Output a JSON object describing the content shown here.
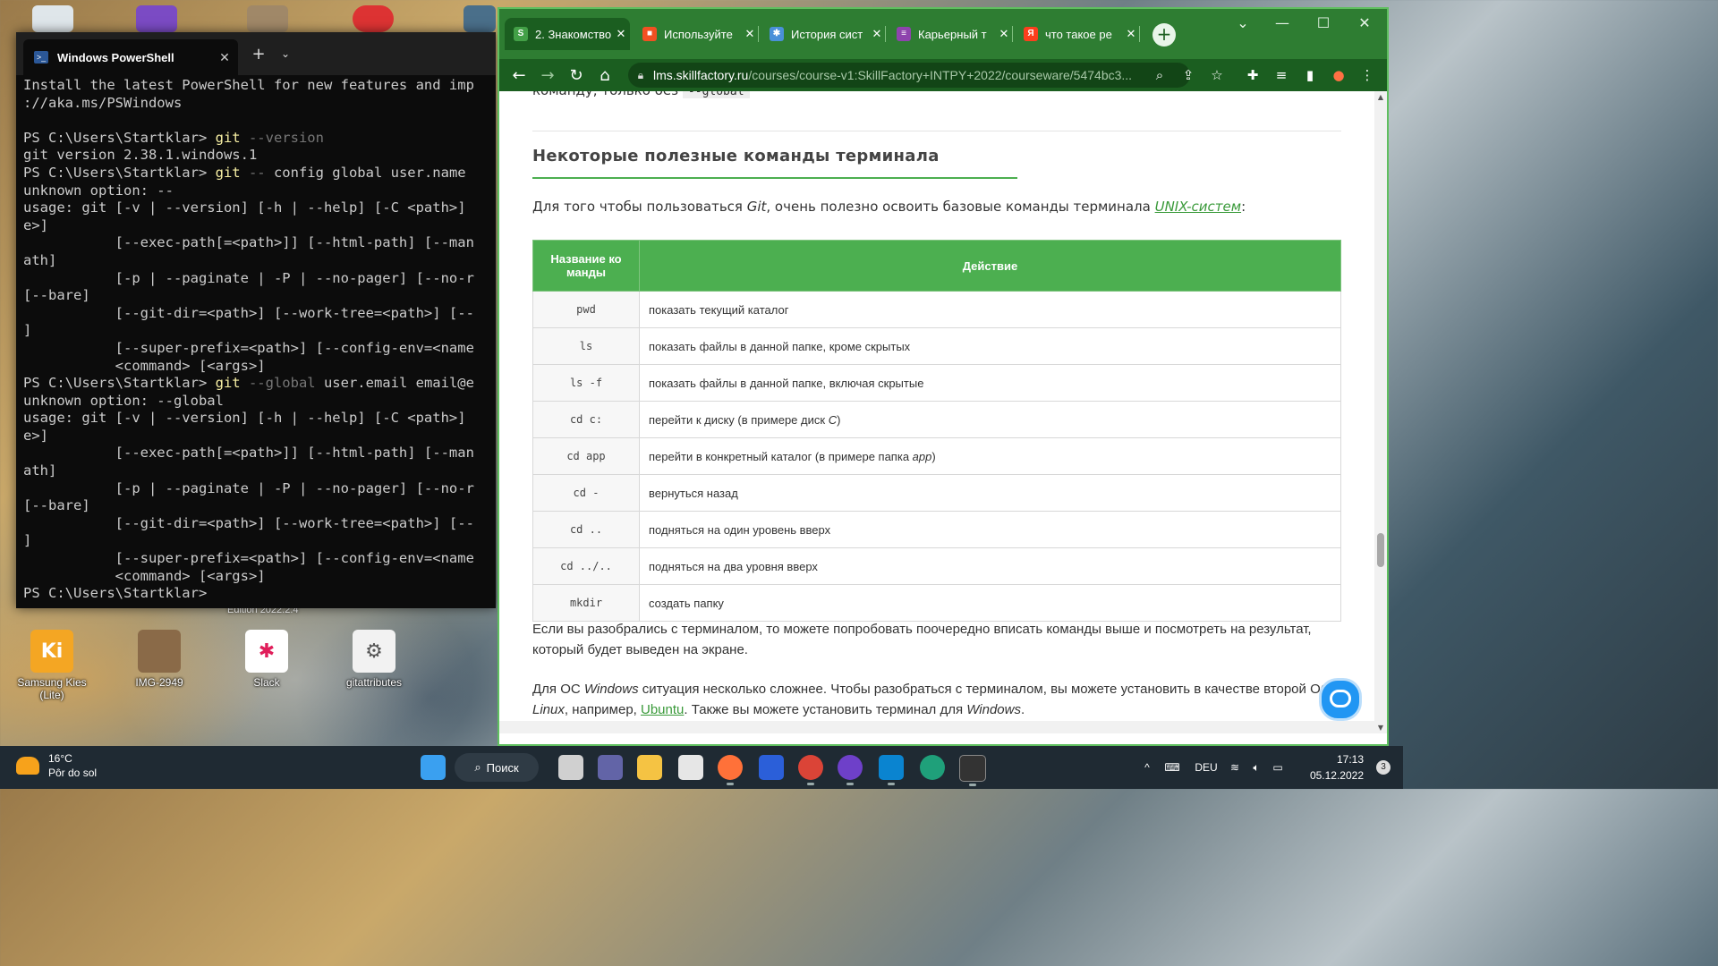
{
  "desktop": {
    "icons": [
      {
        "label": "Samsung Kies (Lite)"
      },
      {
        "label": "IMG-2949"
      },
      {
        "label": "Slack"
      },
      {
        "label": "gitattributes"
      }
    ],
    "partial_label": "Edition 2022.2.4"
  },
  "powershell": {
    "tab_title": "Windows PowerShell",
    "lines": [
      [
        {
          "t": "Install the latest PowerShell for new features and imp"
        }
      ],
      [
        {
          "t": "://aka.ms/PSWindows"
        }
      ],
      [
        {
          "t": ""
        }
      ],
      [
        {
          "t": "PS C:\\Users\\Startklar> "
        },
        {
          "t": "git",
          "c": "cmd"
        },
        {
          "t": " --version",
          "c": "param"
        }
      ],
      [
        {
          "t": "git version 2.38.1.windows.1"
        }
      ],
      [
        {
          "t": "PS C:\\Users\\Startklar> "
        },
        {
          "t": "git",
          "c": "cmd"
        },
        {
          "t": " --",
          "c": "param"
        },
        {
          "t": " config global user.name "
        }
      ],
      [
        {
          "t": "unknown option: --"
        }
      ],
      [
        {
          "t": "usage: git [-v | --version] [-h | --help] [-C <path>] "
        }
      ],
      [
        {
          "t": "e>]"
        }
      ],
      [
        {
          "t": "           [--exec-path[=<path>]] [--html-path] [--man"
        }
      ],
      [
        {
          "t": "ath]"
        }
      ],
      [
        {
          "t": "           [-p | --paginate | -P | --no-pager] [--no-r"
        }
      ],
      [
        {
          "t": "[--bare]"
        }
      ],
      [
        {
          "t": "           [--git-dir=<path>] [--work-tree=<path>] [--"
        }
      ],
      [
        {
          "t": "]"
        }
      ],
      [
        {
          "t": "           [--super-prefix=<path>] [--config-env=<name"
        }
      ],
      [
        {
          "t": "           <command> [<args>]"
        }
      ],
      [
        {
          "t": "PS C:\\Users\\Startklar> "
        },
        {
          "t": "git",
          "c": "cmd"
        },
        {
          "t": " --global",
          "c": "param"
        },
        {
          "t": " user.email email@e"
        }
      ],
      [
        {
          "t": "unknown option: --global"
        }
      ],
      [
        {
          "t": "usage: git [-v | --version] [-h | --help] [-C <path>] "
        }
      ],
      [
        {
          "t": "e>]"
        }
      ],
      [
        {
          "t": "           [--exec-path[=<path>]] [--html-path] [--man"
        }
      ],
      [
        {
          "t": "ath]"
        }
      ],
      [
        {
          "t": "           [-p | --paginate | -P | --no-pager] [--no-r"
        }
      ],
      [
        {
          "t": "[--bare]"
        }
      ],
      [
        {
          "t": "           [--git-dir=<path>] [--work-tree=<path>] [--"
        }
      ],
      [
        {
          "t": "]"
        }
      ],
      [
        {
          "t": "           [--super-prefix=<path>] [--config-env=<name"
        }
      ],
      [
        {
          "t": "           <command> [<args>]"
        }
      ],
      [
        {
          "t": "PS C:\\Users\\Startklar> "
        }
      ]
    ]
  },
  "browser": {
    "tabs": [
      {
        "label": "2. Знакомство",
        "fav": "S",
        "color": "#43a047",
        "active": true
      },
      {
        "label": "Используйте",
        "fav": "■",
        "color": "#f25022"
      },
      {
        "label": "История сист",
        "fav": "✱",
        "color": "#4a90d9"
      },
      {
        "label": "Карьерный т",
        "fav": "≡",
        "color": "#8e44ad"
      },
      {
        "label": "что такое ре",
        "fav": "Я",
        "color": "#fc3f1d"
      }
    ],
    "url_host": "lms.skillfactory.ru",
    "url_path": "/courses/course-v1:SkillFactory+INTPY+2022/courseware/5474bc3...",
    "accent_color": "#4caf50"
  },
  "article": {
    "prev_text": "команду, только без",
    "prev_code": "--global",
    "heading": "Некоторые полезные команды терминала",
    "intro_before": "Для того чтобы пользоваться ",
    "intro_git": "Git",
    "intro_mid": ", очень полезно освоить базовые команды терминала ",
    "intro_link": "UNIX-систем",
    "intro_after": ":",
    "table": {
      "headers": [
        "Название ко манды",
        "Действие"
      ],
      "rows": [
        {
          "cmd": "pwd",
          "action": "показать текущий каталог"
        },
        {
          "cmd": "ls",
          "action": "показать файлы в данной папке, кроме скрытых"
        },
        {
          "cmd": "ls -f",
          "action": "показать файлы в данной папке, включая скрытые"
        },
        {
          "cmd": "cd c:",
          "action": "перейти к диску (в примере диск ",
          "em": "C",
          "after": ")"
        },
        {
          "cmd": "cd app",
          "action": "перейти в конкретный каталог (в примере папка ",
          "em": "app",
          "after": ")"
        },
        {
          "cmd": "cd -",
          "action": "вернуться назад"
        },
        {
          "cmd": "cd ..",
          "action": "подняться на один уровень вверх"
        },
        {
          "cmd": "cd ../..",
          "action": "подняться на два уровня вверх"
        },
        {
          "cmd": "mkdir",
          "action": "создать папку"
        }
      ]
    },
    "para1": "Если вы разобрались с терминалом, то можете попробовать поочередно вписать команды выше и посмотреть на результат, который будет выведен на экране.",
    "para2_a": "Для ОС ",
    "para2_windows": "Windows",
    "para2_b": " ситуация несколько сложнее. Чтобы разобраться с терминалом, вы можете установить в качестве второй ОС ",
    "para2_linux": "Linux",
    "para2_c": ", например, ",
    "para2_link": "Ubuntu",
    "para2_d": ". Также вы можете установить терминал для ",
    "para2_windows2": "Windows",
    "para2_e": "."
  },
  "taskbar": {
    "weather_temp": "16°C",
    "weather_desc": "Pôr do sol",
    "search_label": "Поиск",
    "language": "DEU",
    "time": "17:13",
    "date": "05.12.2022",
    "notification_count": "3"
  }
}
